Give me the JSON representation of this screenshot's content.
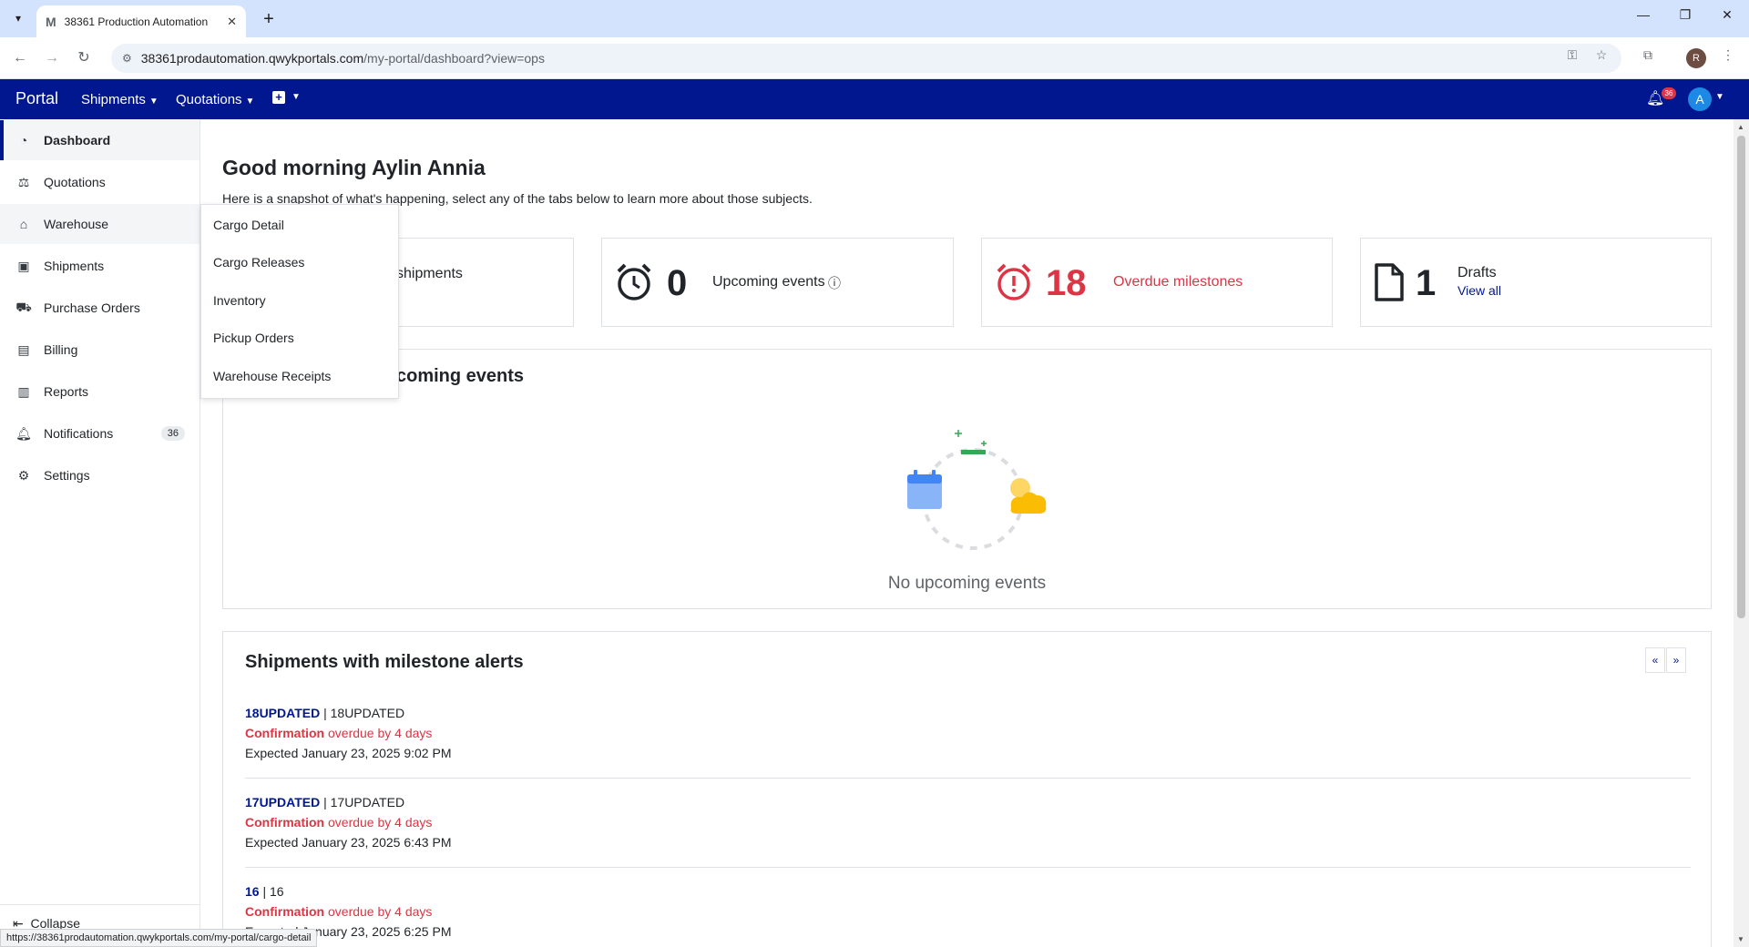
{
  "browser": {
    "tab_title": "38361 Production Automation",
    "tab_favicon": "M",
    "url_host": "38361prodautomation.qwykportals.com",
    "url_path": "/my-portal/dashboard?view=ops",
    "profile_initial": "R",
    "status_url": "https://38361prodautomation.qwykportals.com/my-portal/cargo-detail"
  },
  "header": {
    "brand": "Portal",
    "nav": [
      {
        "label": "Shipments"
      },
      {
        "label": "Quotations"
      }
    ],
    "notification_count": "36",
    "avatar_initial": "A",
    "bg_color": "#00178f"
  },
  "sidebar": {
    "items": [
      {
        "label": "Dashboard",
        "icon": "dashboard-icon"
      },
      {
        "label": "Quotations",
        "icon": "quotations-icon"
      },
      {
        "label": "Warehouse",
        "icon": "warehouse-icon"
      },
      {
        "label": "Shipments",
        "icon": "shipments-icon"
      },
      {
        "label": "Purchase Orders",
        "icon": "cart-icon"
      },
      {
        "label": "Billing",
        "icon": "billing-icon"
      },
      {
        "label": "Reports",
        "icon": "reports-icon"
      },
      {
        "label": "Notifications",
        "icon": "bell-icon",
        "badge": "36"
      },
      {
        "label": "Settings",
        "icon": "gear-icon"
      }
    ],
    "collapse_label": "Collapse"
  },
  "warehouse_menu": {
    "items": [
      "Cargo Detail",
      "Cargo Releases",
      "Inventory",
      "Pickup Orders",
      "Warehouse Receipts"
    ]
  },
  "main": {
    "greeting": "Good morning Aylin Annia",
    "subtext": "Here is a snapshot of what's happening, select any of the tabs below to learn more about those subjects.",
    "cards": [
      {
        "value": "",
        "label": "shipments"
      },
      {
        "value": "0",
        "label": "Upcoming events"
      },
      {
        "value": "18",
        "label": "Overdue milestones"
      },
      {
        "value": "1",
        "label": "Drafts",
        "link": "View all"
      }
    ],
    "events_panel": {
      "title": "coming events",
      "empty_text": "No upcoming events"
    },
    "milestones_panel": {
      "title": "Shipments with milestone alerts",
      "rows": [
        {
          "ref": "18UPDATED",
          "ref2": "18UPDATED",
          "milestone": "Confirmation",
          "status": "overdue by 4 days",
          "expected": "Expected January 23, 2025 9:02 PM"
        },
        {
          "ref": "17UPDATED",
          "ref2": "17UPDATED",
          "milestone": "Confirmation",
          "status": "overdue by 4 days",
          "expected": "Expected January 23, 2025 6:43 PM"
        },
        {
          "ref": "16",
          "ref2": "16",
          "milestone": "Confirmation",
          "status": "overdue by 4 days",
          "expected": "Expected January 23, 2025 6:25 PM"
        }
      ]
    }
  }
}
